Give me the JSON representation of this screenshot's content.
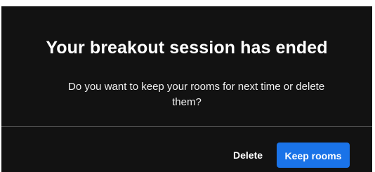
{
  "dialog": {
    "title": "Your breakout session has ended",
    "message_line1": "Do you want to keep your rooms for next time or delete",
    "message_line2": "them?",
    "delete_label": "Delete",
    "keep_label": "Keep rooms"
  },
  "colors": {
    "background": "#121212",
    "accent": "#1a73e8",
    "divider": "#5a5a5a"
  }
}
